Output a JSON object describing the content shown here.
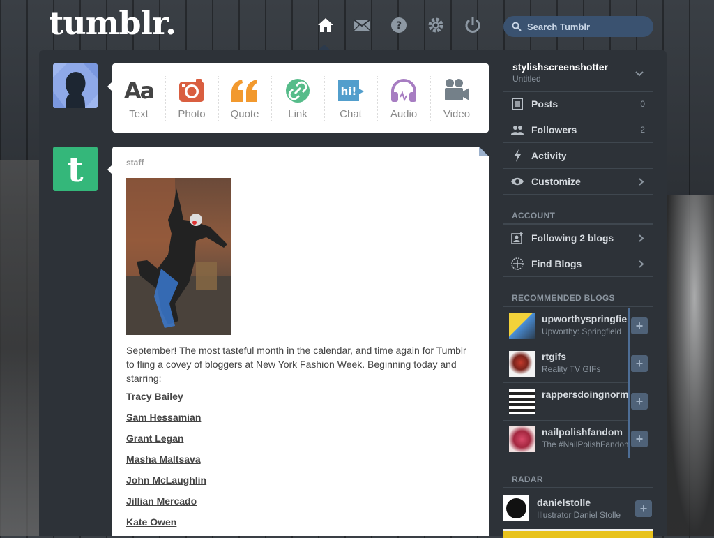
{
  "header": {
    "logo": "tumblr.",
    "search_placeholder": "Search Tumblr",
    "nav": [
      "home-icon",
      "mail-icon",
      "help-icon",
      "gear-icon",
      "power-icon"
    ]
  },
  "composer": {
    "types": [
      {
        "label": "Text",
        "icon": "text-icon",
        "color": "#444444"
      },
      {
        "label": "Photo",
        "icon": "camera-icon",
        "color": "#d95e40"
      },
      {
        "label": "Quote",
        "icon": "quote-icon",
        "color": "#f2992e"
      },
      {
        "label": "Link",
        "icon": "link-icon",
        "color": "#56bc8a"
      },
      {
        "label": "Chat",
        "icon": "chat-icon",
        "color": "#529ecc"
      },
      {
        "label": "Audio",
        "icon": "headphones-icon",
        "color": "#a77dc2"
      },
      {
        "label": "Video",
        "icon": "video-camera-icon",
        "color": "#748089"
      }
    ]
  },
  "post": {
    "author": "staff",
    "avatar_letter": "t",
    "body": "September! The most tasteful month in the calendar, and time again for Tumblr to fling a covey of bloggers at New York Fashion Week. Beginning today and starring:",
    "links": [
      "Tracy Bailey",
      "Sam Hessamian",
      "Grant Legan",
      "Masha Maltsava",
      "John McLaughlin",
      "Jillian Mercado",
      "Kate Owen"
    ]
  },
  "sidebar": {
    "blog_name": "stylishscreenshotter",
    "blog_subtitle": "Untitled",
    "items": [
      {
        "label": "Posts",
        "count": "0",
        "icon": "posts-icon"
      },
      {
        "label": "Followers",
        "count": "2",
        "icon": "followers-icon"
      },
      {
        "label": "Activity",
        "count": "",
        "icon": "lightning-icon"
      },
      {
        "label": "Customize",
        "count": "",
        "icon": "eye-icon"
      }
    ],
    "account_heading": "ACCOUNT",
    "account_items": [
      {
        "label": "Following 2 blogs",
        "icon": "following-icon"
      },
      {
        "label": "Find Blogs",
        "icon": "compass-icon"
      }
    ],
    "recommended_heading": "RECOMMENDED BLOGS",
    "recommended": [
      {
        "name": "upworthyspringfield",
        "desc": "Upworthy: Springfield"
      },
      {
        "name": "rtgifs",
        "desc": "Reality TV GIFs"
      },
      {
        "name": "rappersdoingnormal",
        "desc": ""
      },
      {
        "name": "nailpolishfandom",
        "desc": "The #NailPolishFandom"
      }
    ],
    "radar_heading": "RADAR",
    "radar": {
      "name": "danielstolle",
      "desc": "Illustrator Daniel Stolle"
    },
    "follow_symbol": "+"
  },
  "colors": {
    "accent": "#529ecc",
    "panel": "#2d3238",
    "staff_green": "#34b77a"
  }
}
